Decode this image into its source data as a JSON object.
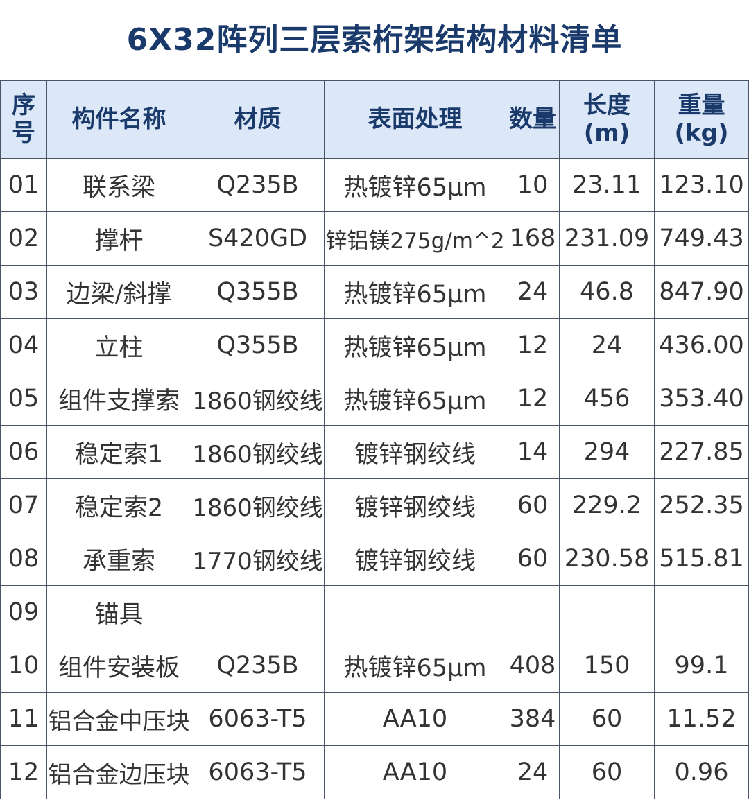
{
  "title": "6X32阵列三层索桁架结构材料清单",
  "headers": {
    "seq": "序\n号",
    "name": "构件名称",
    "material": "材质",
    "surface": "表面处理",
    "qty": "数量",
    "length": "长度\n(m)",
    "weight": "重量\n(kg)"
  },
  "rows": [
    {
      "seq": "01",
      "name": "联系梁",
      "material": "Q235B",
      "surface": "热镀锌65μm",
      "qty": "10",
      "length": "23.11",
      "weight": "123.10"
    },
    {
      "seq": "02",
      "name": "撑杆",
      "material": "S420GD",
      "surface": "锌铝镁275g/m^2",
      "qty": "168",
      "length": "231.09",
      "weight": "749.43"
    },
    {
      "seq": "03",
      "name": "边梁/斜撑",
      "material": "Q355B",
      "surface": "热镀锌65μm",
      "qty": "24",
      "length": "46.8",
      "weight": "847.90"
    },
    {
      "seq": "04",
      "name": "立柱",
      "material": "Q355B",
      "surface": "热镀锌65μm",
      "qty": "12",
      "length": "24",
      "weight": "436.00"
    },
    {
      "seq": "05",
      "name": "组件支撑索",
      "material": "1860钢绞线",
      "surface": "热镀锌65μm",
      "qty": "12",
      "length": "456",
      "weight": "353.40"
    },
    {
      "seq": "06",
      "name": "稳定索1",
      "material": "1860钢绞线",
      "surface": "镀锌钢绞线",
      "qty": "14",
      "length": "294",
      "weight": "227.85"
    },
    {
      "seq": "07",
      "name": "稳定索2",
      "material": "1860钢绞线",
      "surface": "镀锌钢绞线",
      "qty": "60",
      "length": "229.2",
      "weight": "252.35"
    },
    {
      "seq": "08",
      "name": "承重索",
      "material": "1770钢绞线",
      "surface": "镀锌钢绞线",
      "qty": "60",
      "length": "230.58",
      "weight": "515.81"
    },
    {
      "seq": "09",
      "name": "锚具",
      "material": "",
      "surface": "",
      "qty": "",
      "length": "",
      "weight": ""
    },
    {
      "seq": "10",
      "name": "组件安装板",
      "material": "Q235B",
      "surface": "热镀锌65μm",
      "qty": "408",
      "length": "150",
      "weight": "99.1"
    },
    {
      "seq": "11",
      "name": "铝合金中压块",
      "material": "6063-T5",
      "surface": "AA10",
      "qty": "384",
      "length": "60",
      "weight": "11.52"
    },
    {
      "seq": "12",
      "name": "铝合金边压块",
      "material": "6063-T5",
      "surface": "AA10",
      "qty": "24",
      "length": "60",
      "weight": "0.96"
    }
  ]
}
